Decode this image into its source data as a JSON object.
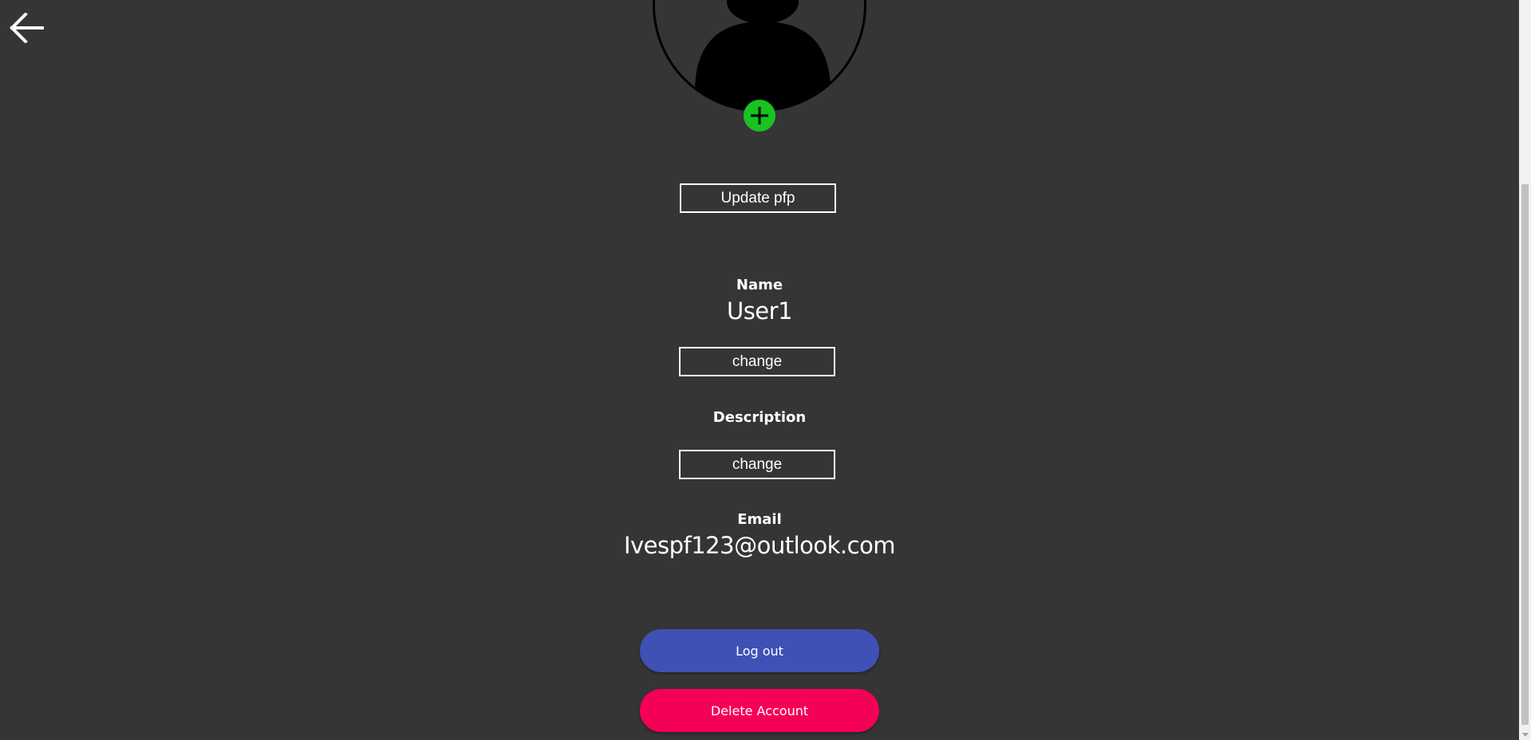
{
  "colors": {
    "background": "#353535",
    "add_button": "#19c221",
    "logout_button": "#3f51b5",
    "delete_button": "#f50057"
  },
  "header": {
    "back_icon": "arrow-left-icon"
  },
  "profile": {
    "add_icon": "plus-icon",
    "update_pfp_label": "Update pfp"
  },
  "name": {
    "label": "Name",
    "value": "User1",
    "change_label": "change"
  },
  "description": {
    "label": "Description",
    "change_label": "change"
  },
  "email": {
    "label": "Email",
    "value": "Ivespf123@outlook.com"
  },
  "actions": {
    "logout_label": "Log out",
    "delete_label": "Delete Account"
  }
}
